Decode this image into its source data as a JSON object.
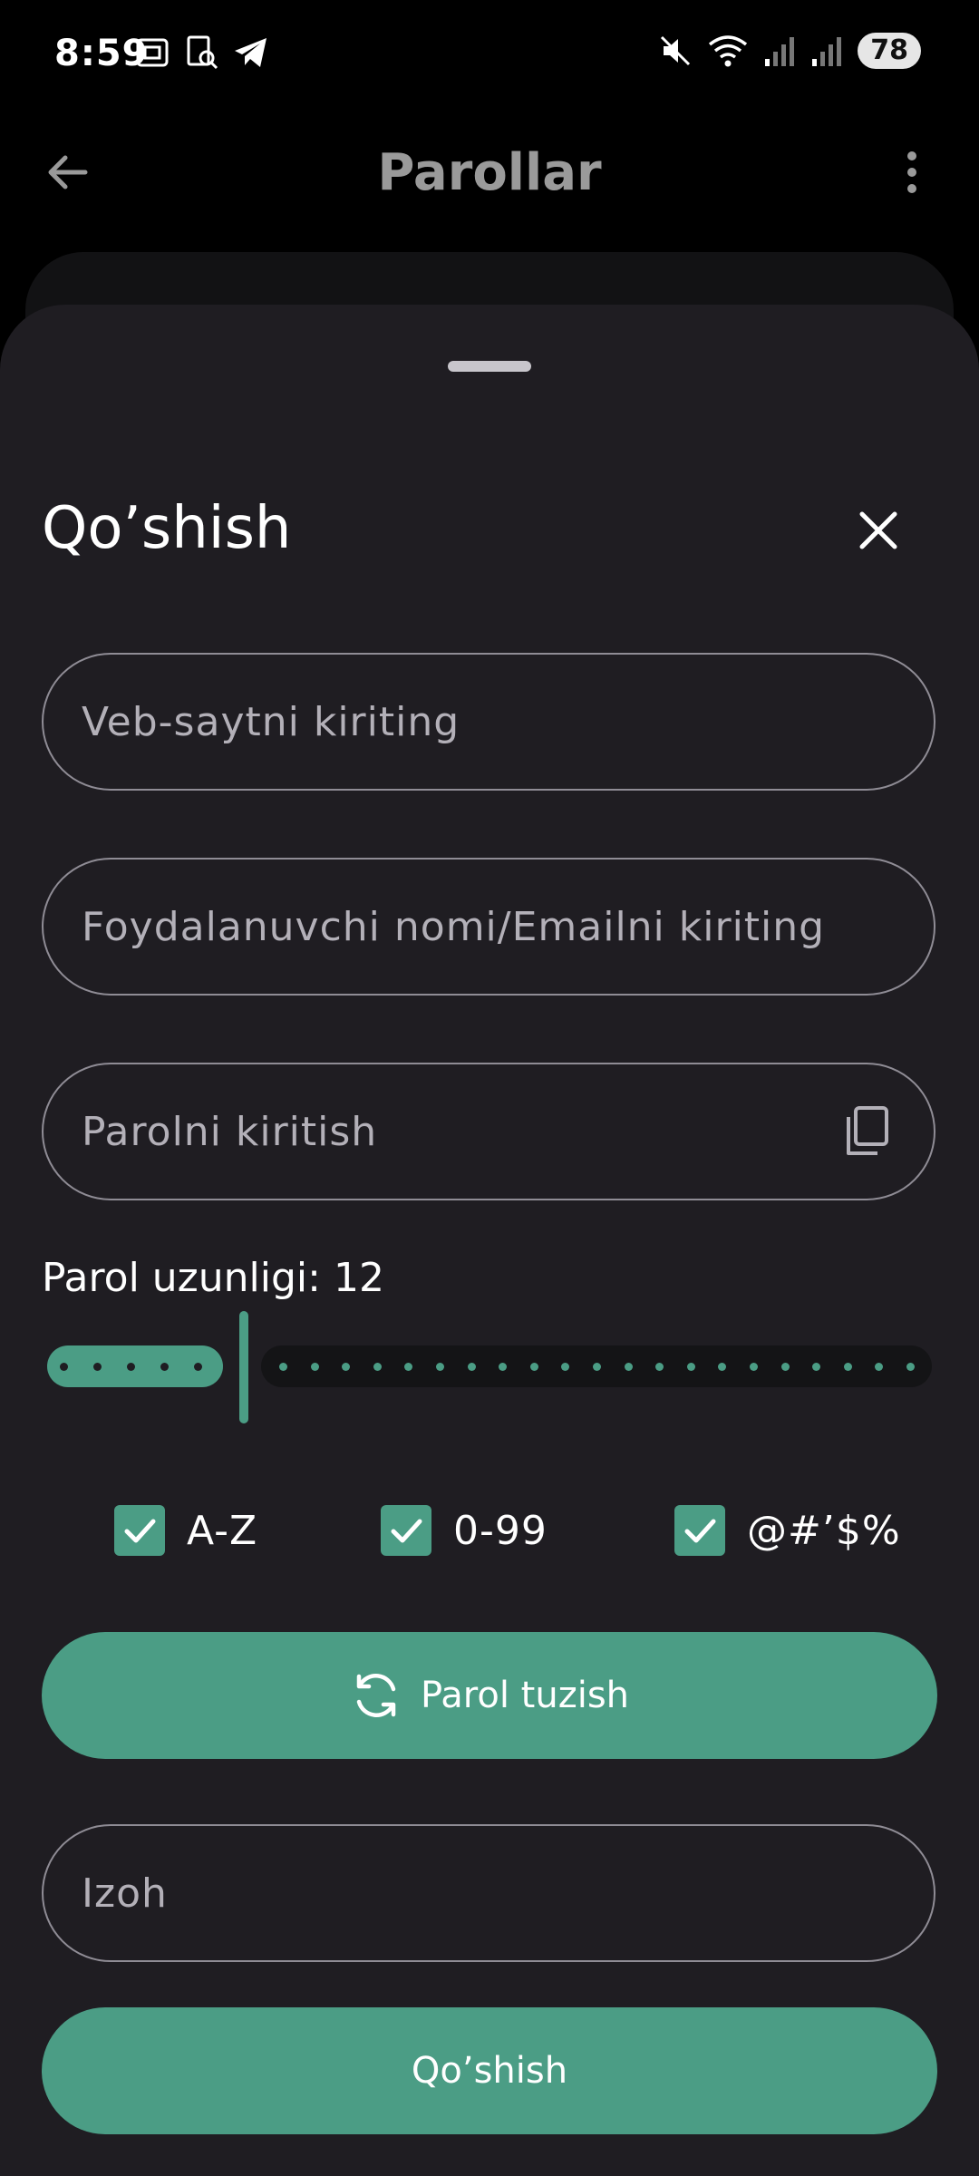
{
  "status_bar": {
    "time": "8:59",
    "battery": "78"
  },
  "app_bar": {
    "title": "Parollar"
  },
  "sheet": {
    "title": "Qo’shish",
    "website_placeholder": "Veb-saytni kiriting",
    "username_placeholder": "Foydalanuvchi nomi/Emailni kiriting",
    "password_placeholder": "Parolni kiritish",
    "length_label": "Parol uzunligi: 12",
    "length_value": 12,
    "options": [
      {
        "label": "A-Z",
        "checked": true
      },
      {
        "label": "0-99",
        "checked": true
      },
      {
        "label": "@#’$%",
        "checked": true
      }
    ],
    "generate_button": "Parol tuzish",
    "note_placeholder": "Izoh",
    "submit_button": "Qo’shish"
  },
  "colors": {
    "accent": "#4b9d85",
    "sheet_bg": "#1f1d22",
    "background": "#000000"
  },
  "icons": [
    "back-arrow-icon",
    "more-vert-icon",
    "close-icon",
    "copy-icon",
    "refresh-icon",
    "check-icon"
  ]
}
